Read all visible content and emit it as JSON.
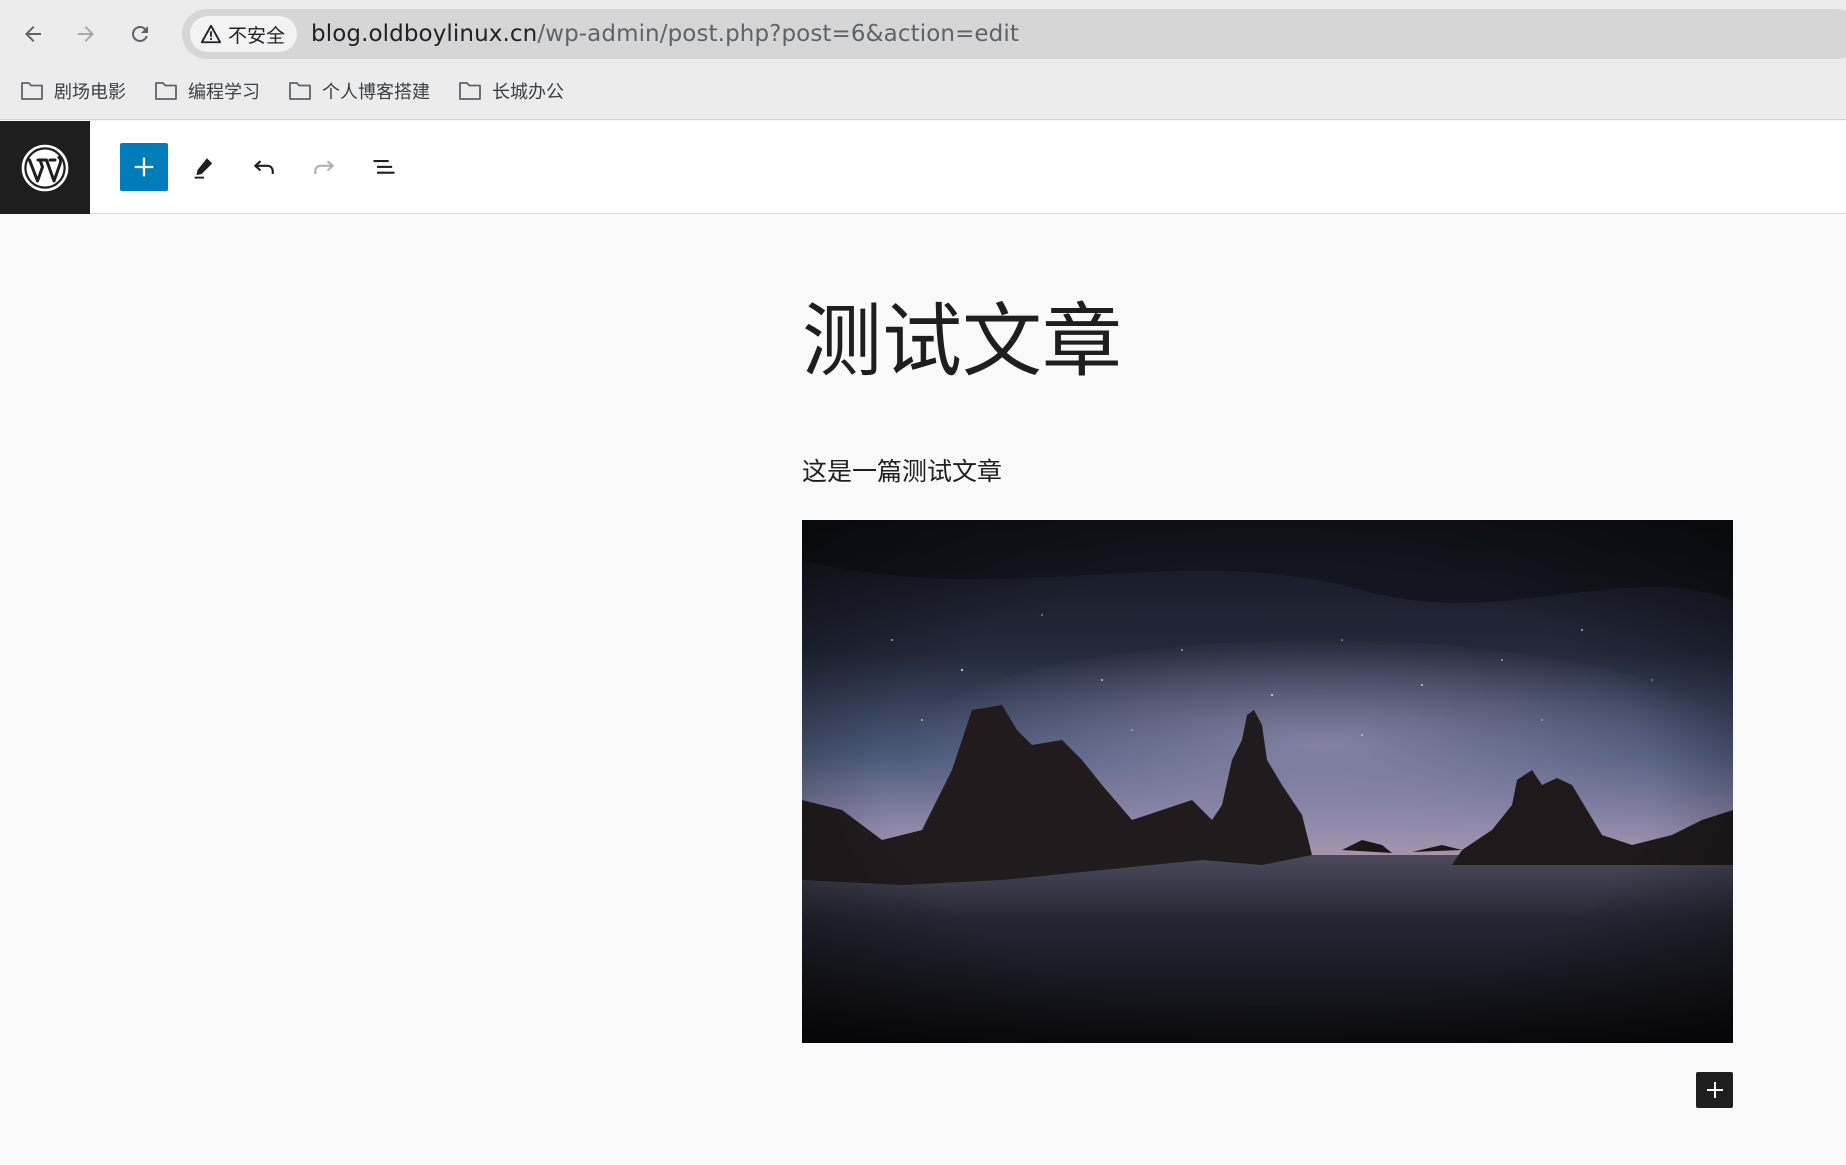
{
  "browser": {
    "security_label": "不安全",
    "url_host": "blog.oldboylinux.cn",
    "url_path": "/wp-admin/post.php?post=6&action=edit",
    "bookmarks": [
      {
        "label": "剧场电影",
        "icon": "folder-icon"
      },
      {
        "label": "编程学习",
        "icon": "folder-icon"
      },
      {
        "label": "个人博客搭建",
        "icon": "folder-icon"
      },
      {
        "label": "长城办公",
        "icon": "folder-icon"
      }
    ]
  },
  "toolbar": {
    "logo_icon": "wordpress-logo-icon",
    "tools": [
      "plus-icon",
      "pencil-icon",
      "undo-icon",
      "redo-icon",
      "list-view-icon"
    ],
    "accent_color": "#007cba"
  },
  "post": {
    "title": "测试文章",
    "paragraph": "这是一篇测试文章"
  },
  "colors": {
    "editor_bg": "#f9f9f9",
    "logo_bg": "#1e1e1e",
    "omnibox_bg": "#d6d6d6"
  }
}
